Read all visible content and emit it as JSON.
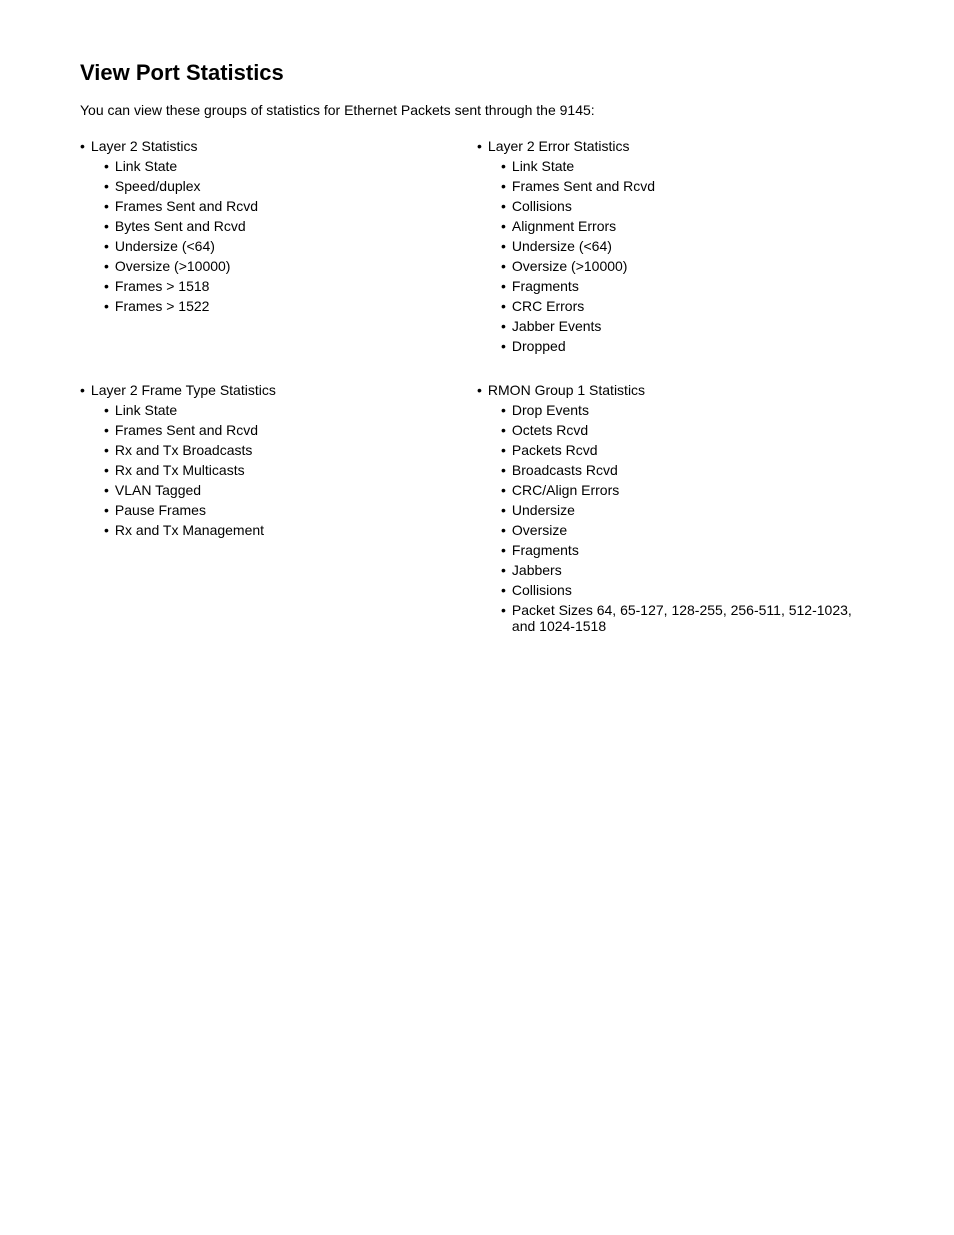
{
  "page": {
    "title": "View Port Statistics",
    "intro": "You can view these groups of statistics for Ethernet Packets sent through the 9145:",
    "columns_row1": [
      {
        "heading": "Layer 2 Statistics",
        "items": [
          "Link State",
          "Speed/duplex",
          "Frames Sent and Rcvd",
          "Bytes Sent and Rcvd",
          "Undersize (<64)",
          "Oversize (>10000)",
          "Frames > 1518",
          "Frames > 1522"
        ]
      },
      {
        "heading": "Layer 2 Error Statistics",
        "items": [
          "Link State",
          "Frames Sent and Rcvd",
          "Collisions",
          "Alignment Errors",
          "Undersize (<64)",
          "Oversize (>10000)",
          "Fragments",
          "CRC Errors",
          "Jabber Events",
          "Dropped"
        ]
      }
    ],
    "columns_row2": [
      {
        "heading": "Layer 2 Frame Type Statistics",
        "items": [
          "Link State",
          "Frames Sent and Rcvd",
          "Rx and Tx Broadcasts",
          "Rx and Tx Multicasts",
          "VLAN Tagged",
          "Pause Frames",
          "Rx and Tx Management"
        ]
      },
      {
        "heading": "RMON Group 1 Statistics",
        "items": [
          "Drop Events",
          "Octets Rcvd",
          "Packets Rcvd",
          "Broadcasts Rcvd",
          "CRC/Align Errors",
          "Undersize",
          "Oversize",
          "Fragments",
          "Jabbers",
          "Collisions",
          "Packet Sizes 64, 65-127, 128-255, 256-511, 512-1023, and 1024-1518"
        ]
      }
    ],
    "bullet": "•"
  }
}
